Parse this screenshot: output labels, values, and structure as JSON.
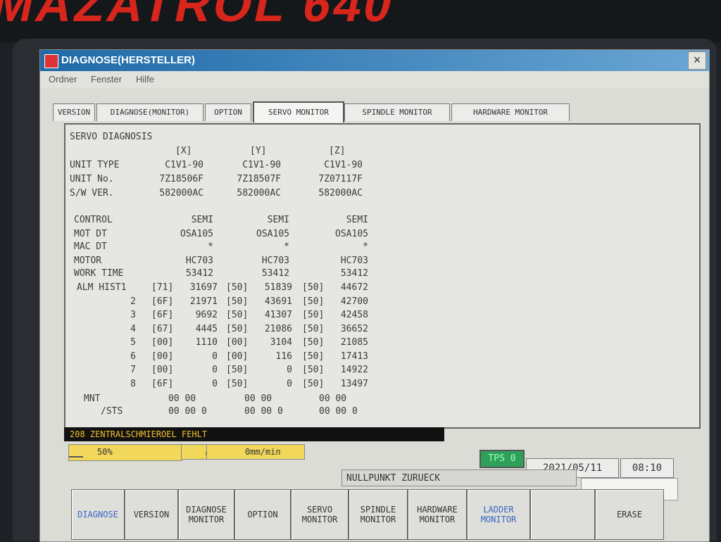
{
  "brand": "MAZATROL 640",
  "window": {
    "title": "DIAGNOSE(HERSTELLER)",
    "close_glyph": "×"
  },
  "menu": [
    "Ordner",
    "Fenster",
    "Hilfe"
  ],
  "tabs": [
    "VERSION",
    "DIAGNOSE(MONITOR)",
    "OPTION",
    "SERVO MONITOR",
    "SPINDLE MONITOR",
    "HARDWARE MONITOR"
  ],
  "active_tab": "SERVO MONITOR",
  "servo": {
    "heading": "SERVO DIAGNOSIS",
    "axes": [
      "[X]",
      "[Y]",
      "[Z]"
    ],
    "labels": {
      "unit_type": "UNIT TYPE",
      "unit_no": "UNIT No.",
      "sw_ver": "S/W VER.",
      "control": "CONTROL",
      "mot_dt": "MOT DT",
      "mac_dt": "MAC DT",
      "motor": "MOTOR",
      "work_time": "WORK TIME",
      "alm_hist": "ALM HIST1",
      "mnt": "MNT",
      "sts": "/STS"
    },
    "unit_type": [
      "C1V1-90",
      "C1V1-90",
      "C1V1-90"
    ],
    "unit_no": [
      "7Z18506F",
      "7Z18507F",
      "7Z07117F"
    ],
    "sw_ver": [
      "582000AC",
      "582000AC",
      "582000AC"
    ],
    "control": [
      "SEMI",
      "SEMI",
      "SEMI"
    ],
    "mot_dt": [
      "OSA105",
      "OSA105",
      "OSA105"
    ],
    "mac_dt": [
      "*",
      "*",
      "*"
    ],
    "motor": [
      "HC703",
      "HC703",
      "HC703"
    ],
    "work_time": [
      "53412",
      "53412",
      "53412"
    ],
    "alm_hist": [
      {
        "n": "",
        "x": [
          "[71]",
          "31697"
        ],
        "y": [
          "[50]",
          "51839"
        ],
        "z": [
          "[50]",
          "44672"
        ]
      },
      {
        "n": "2",
        "x": [
          "[6F]",
          "21971"
        ],
        "y": [
          "[50]",
          "43691"
        ],
        "z": [
          "[50]",
          "42700"
        ]
      },
      {
        "n": "3",
        "x": [
          "[6F]",
          "9692"
        ],
        "y": [
          "[50]",
          "41307"
        ],
        "z": [
          "[50]",
          "42458"
        ]
      },
      {
        "n": "4",
        "x": [
          "[67]",
          "4445"
        ],
        "y": [
          "[50]",
          "21086"
        ],
        "z": [
          "[50]",
          "36652"
        ]
      },
      {
        "n": "5",
        "x": [
          "[00]",
          "1110"
        ],
        "y": [
          "[00]",
          "3104"
        ],
        "z": [
          "[50]",
          "21085"
        ]
      },
      {
        "n": "6",
        "x": [
          "[00]",
          "0"
        ],
        "y": [
          "[00]",
          "116"
        ],
        "z": [
          "[50]",
          "17413"
        ]
      },
      {
        "n": "7",
        "x": [
          "[00]",
          "0"
        ],
        "y": [
          "[50]",
          "0"
        ],
        "z": [
          "[50]",
          "14922"
        ]
      },
      {
        "n": "8",
        "x": [
          "[6F]",
          "0"
        ],
        "y": [
          "[50]",
          "0"
        ],
        "z": [
          "[50]",
          "13497"
        ]
      }
    ],
    "mnt": [
      "00 00",
      "00 00",
      "00 00"
    ],
    "sts": [
      "00 00 0",
      "00 00 0",
      "00 00 0"
    ]
  },
  "alarm_message": "208 ZENTRALSCHMIEROEL FEHLT",
  "override": {
    "percent": "50%",
    "spindle": "0min",
    "spindle_sup": "-1",
    "feed": "0mm/min"
  },
  "tps": "TPS 0",
  "date": "2021/05/11",
  "time": "08:10",
  "message": "NULLPUNKT ZURUECK",
  "softkeys": [
    {
      "l1": "DIAGNOSE",
      "l2": ""
    },
    {
      "l1": "VERSION",
      "l2": ""
    },
    {
      "l1": "DIAGNOSE",
      "l2": "MONITOR"
    },
    {
      "l1": "OPTION",
      "l2": ""
    },
    {
      "l1": "SERVO",
      "l2": "MONITOR"
    },
    {
      "l1": "SPINDLE",
      "l2": "MONITOR"
    },
    {
      "l1": "HARDWARE",
      "l2": "MONITOR"
    },
    {
      "l1": "LADDER",
      "l2": "MONITOR"
    },
    {
      "l1": "",
      "l2": ""
    },
    {
      "l1": "ERASE",
      "l2": ""
    }
  ],
  "colors": {
    "titlebar": "#1f6aa8",
    "tps_bg": "#2ea05a",
    "alarm_text": "#f0c030",
    "override_bg": "#f1d75a",
    "softkey_blue": "#3866c4"
  }
}
